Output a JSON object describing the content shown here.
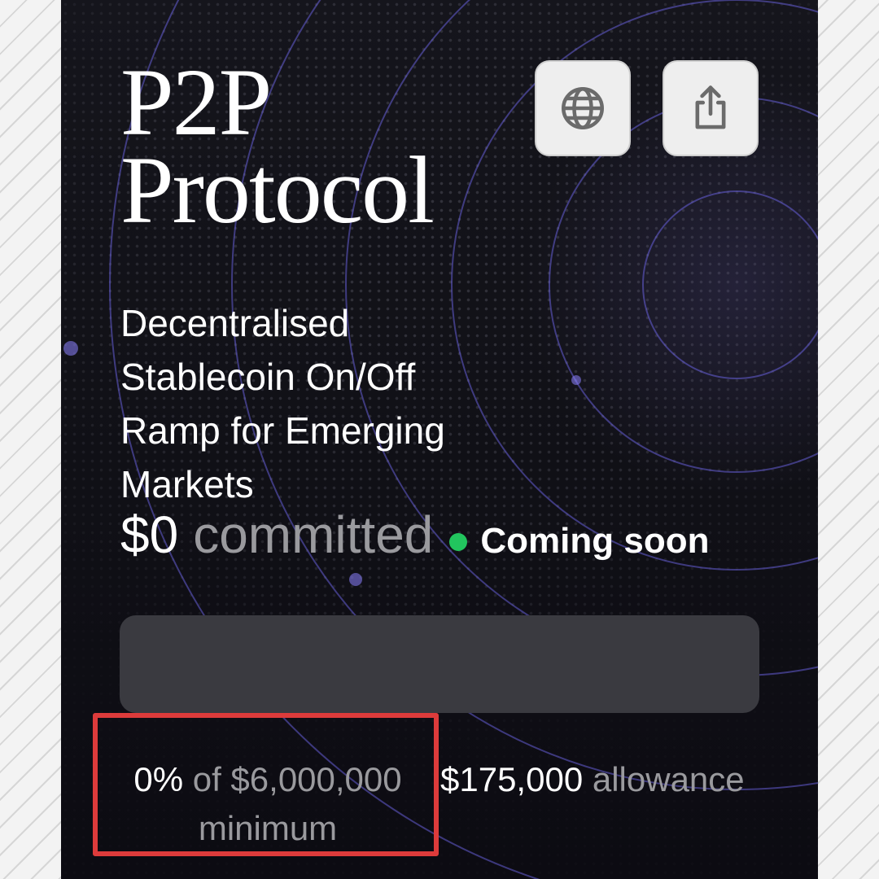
{
  "project": {
    "title_line1": "P2P",
    "title_line2": "Protocol",
    "tagline_lines": [
      "Decentralised",
      "Stablecoin On/Off",
      "Ramp for Emerging",
      "Markets"
    ]
  },
  "actions": {
    "website_icon": "globe-icon",
    "share_icon": "share-icon"
  },
  "commitment": {
    "amount": "$0",
    "label": "committed",
    "status": "Coming soon",
    "status_color": "#22c55e",
    "progress_fraction": 0
  },
  "stats": {
    "percent": "0%",
    "of_minimum": "of $6,000,000",
    "minimum_label": "minimum",
    "allowance_amount": "$175,000",
    "allowance_label": "allowance"
  },
  "colors": {
    "highlight": "#dd3b3b",
    "card_background": "#101016"
  }
}
